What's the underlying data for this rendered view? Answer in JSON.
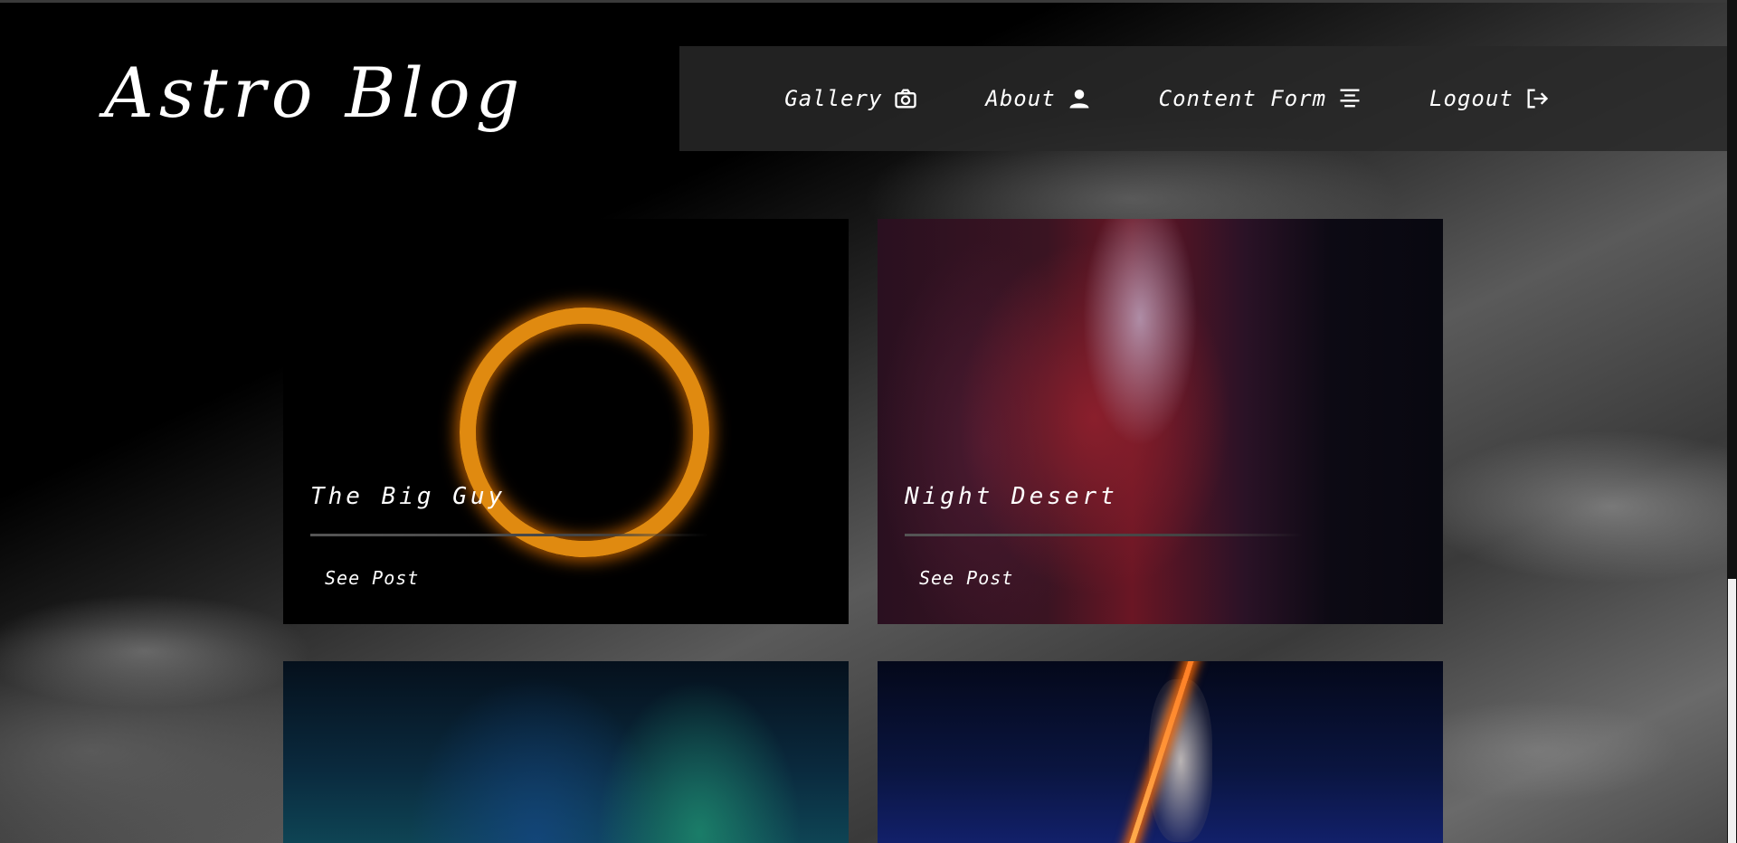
{
  "site": {
    "logo": "Astro Blog"
  },
  "nav": {
    "items": [
      {
        "label": "Gallery",
        "icon": "camera-icon"
      },
      {
        "label": "About",
        "icon": "user-icon"
      },
      {
        "label": "Content Form",
        "icon": "align-center-icon"
      },
      {
        "label": "Logout",
        "icon": "logout-icon"
      }
    ]
  },
  "posts": [
    {
      "title": "The Big Guy",
      "link_label": "See Post"
    },
    {
      "title": "Night Desert",
      "link_label": "See Post"
    },
    {
      "title": "",
      "link_label": ""
    },
    {
      "title": "",
      "link_label": ""
    }
  ]
}
